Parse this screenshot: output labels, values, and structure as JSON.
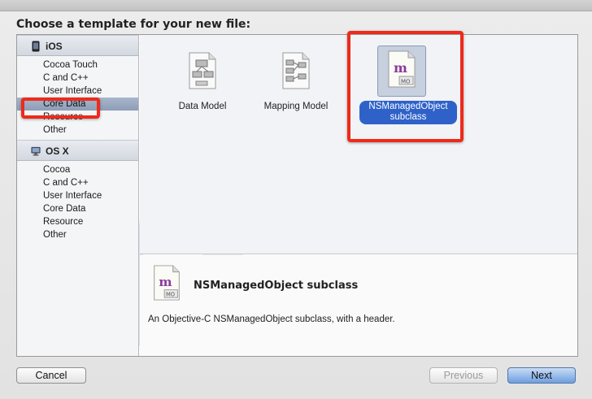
{
  "dialog": {
    "title": "Choose a template for your new file:"
  },
  "sidebar": {
    "sections": [
      {
        "label": "iOS",
        "icon": "iphone-icon",
        "items": [
          "Cocoa Touch",
          "C and C++",
          "User Interface",
          "Core Data",
          "Resource",
          "Other"
        ],
        "selected_index": 3
      },
      {
        "label": "OS X",
        "icon": "mac-icon",
        "items": [
          "Cocoa",
          "C and C++",
          "User Interface",
          "Core Data",
          "Resource",
          "Other"
        ]
      }
    ]
  },
  "templates": [
    {
      "label": "Data Model",
      "icon": "data-model-icon"
    },
    {
      "label": "Mapping Model",
      "icon": "mapping-model-icon"
    },
    {
      "label_line1": "NSManagedObject",
      "label_line2": "subclass",
      "icon": "managed-object-icon",
      "selected": true
    }
  ],
  "description": {
    "title": "NSManagedObject subclass",
    "text": "An Objective-C NSManagedObject subclass, with a header.",
    "icon": "managed-object-icon",
    "icon_letter": "m",
    "icon_badge": "MO"
  },
  "buttons": {
    "cancel": "Cancel",
    "previous": "Previous",
    "next": "Next"
  },
  "colors": {
    "highlight": "#ee2a1b",
    "selection": "#2f62c9",
    "default_button": "#6e9fe0"
  }
}
